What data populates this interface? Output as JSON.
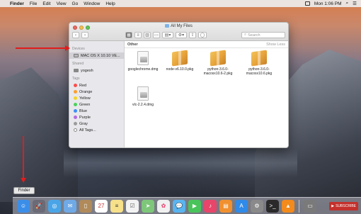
{
  "menubar": {
    "apple": "",
    "items": [
      "Finder",
      "File",
      "Edit",
      "View",
      "Go",
      "Window",
      "Help"
    ],
    "clock": "Mon 1:06 PM"
  },
  "window": {
    "title": "All My Files",
    "search_placeholder": "Search"
  },
  "sidebar": {
    "devices_header": "Devices",
    "devices": [
      {
        "label": "MAC OS X 10.10 VE...",
        "icon": "hard-drive-icon"
      }
    ],
    "shared_header": "Shared",
    "shared": [
      {
        "label": "yogesh",
        "icon": "computer-icon"
      }
    ],
    "tags_header": "Tags",
    "tags": [
      {
        "label": "Red",
        "color": "#ff4b4b"
      },
      {
        "label": "Orange",
        "color": "#ff9d2e"
      },
      {
        "label": "Yellow",
        "color": "#f5d327"
      },
      {
        "label": "Green",
        "color": "#4cd15c"
      },
      {
        "label": "Blue",
        "color": "#3e8ef7"
      },
      {
        "label": "Purple",
        "color": "#b36ae2"
      },
      {
        "label": "Gray",
        "color": "#9a9a9a"
      },
      {
        "label": "All Tags...",
        "color": ""
      }
    ]
  },
  "content": {
    "section": "Other",
    "show_less": "Show Less",
    "files": [
      {
        "name": "googlechrome.dmg",
        "type": "dmg"
      },
      {
        "name": "node-v6.10.0.pkg",
        "type": "pkg"
      },
      {
        "name": "python-3.6.0-macosx10.6-2.pkg",
        "type": "pkg"
      },
      {
        "name": "python-3.6.0-macosx10.6.pkg",
        "type": "pkg"
      },
      {
        "name": "vlc-2.2.4.dmg",
        "type": "dmg"
      }
    ]
  },
  "tooltip": "Finder",
  "dock": {
    "subscribe": "SUBSCRIBE",
    "apps": [
      {
        "name": "finder-icon",
        "color": "#3b8ee8"
      },
      {
        "name": "launchpad-icon",
        "color": "#6b6b78"
      },
      {
        "name": "safari-icon",
        "color": "#4aa5e8"
      },
      {
        "name": "mail-icon",
        "color": "#6fa9e6"
      },
      {
        "name": "contacts-icon",
        "color": "#b08a5a"
      },
      {
        "name": "calendar-icon",
        "color": "#ffffff"
      },
      {
        "name": "notes-icon",
        "color": "#f6e08a"
      },
      {
        "name": "reminders-icon",
        "color": "#f2f2f2"
      },
      {
        "name": "maps-icon",
        "color": "#7ec77a"
      },
      {
        "name": "photos-icon",
        "color": "#f0f0f0"
      },
      {
        "name": "messages-icon",
        "color": "#59b4f0"
      },
      {
        "name": "facetime-icon",
        "color": "#49c45a"
      },
      {
        "name": "itunes-icon",
        "color": "#e8456a"
      },
      {
        "name": "ibooks-icon",
        "color": "#f0902f"
      },
      {
        "name": "app-store-icon",
        "color": "#2f8ae8"
      },
      {
        "name": "system-preferences-icon",
        "color": "#8a8a8a"
      },
      {
        "name": "terminal-icon",
        "color": "#2a2a2a"
      },
      {
        "name": "vlc-icon",
        "color": "#f28a1c"
      },
      {
        "name": "app-icon",
        "color": "#7a7a7a"
      }
    ]
  }
}
